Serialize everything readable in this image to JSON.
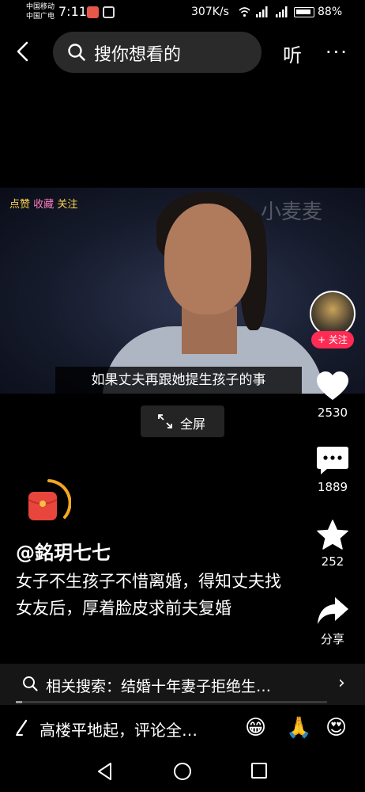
{
  "status_bar": {
    "carrier_1": "中国移动",
    "carrier_2": "中国广电",
    "time": "7:11",
    "net_speed": "307K/s",
    "battery": "88%"
  },
  "top_bar": {
    "search_placeholder": "搜你想看的",
    "listen_label": "听",
    "more_label": "···"
  },
  "video": {
    "sticker_text_1": "点赞",
    "sticker_text_2": "收藏",
    "sticker_text_3": "关注",
    "watermark": "小麦麦",
    "subtitle": "如果丈夫再跟她提生孩子的事"
  },
  "fullscreen_label": "全屏",
  "right_rail": {
    "follow_label": "+ 关注",
    "like_count": "2530",
    "comment_count": "1889",
    "favorite_count": "252",
    "share_label": "分享"
  },
  "info": {
    "author": "@銘玥七七",
    "caption": "女子不生孩子不惜离婚，得知丈夫找女友后，厚着脸皮求前夫复婚"
  },
  "related_search": {
    "text": "相关搜索：结婚十年妻子拒绝生…"
  },
  "comment_bar": {
    "placeholder": "高楼平地起，评论全…",
    "emoji_1": "😁",
    "emoji_2": "🙏",
    "emoji_3": "😍"
  },
  "colors": {
    "accent": "#fe2c55",
    "background": "#000000",
    "panel": "#161616"
  },
  "icons": [
    "back-icon",
    "search-icon",
    "fullscreen-icon",
    "heart-icon",
    "comment-icon",
    "star-icon",
    "share-icon",
    "redpacket-icon",
    "pen-icon"
  ]
}
